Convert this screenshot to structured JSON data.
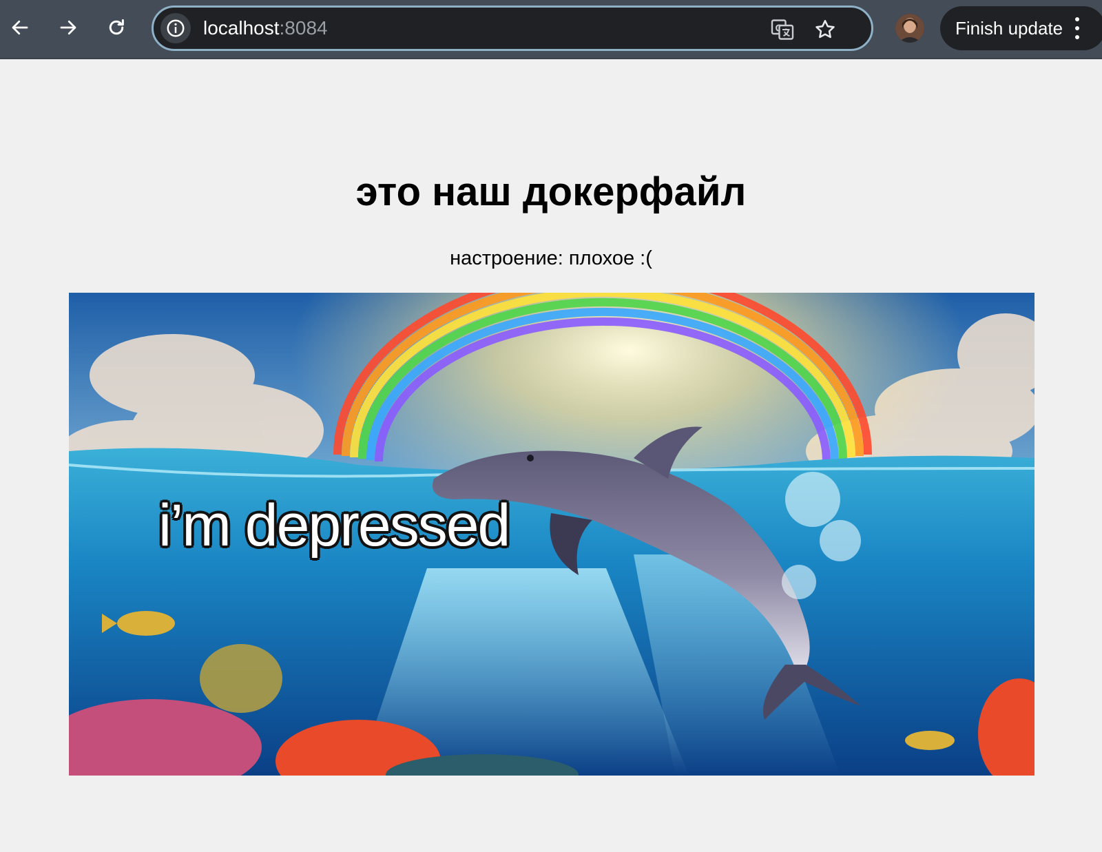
{
  "browser": {
    "url_host": "localhost",
    "url_port": ":8084",
    "update_button_label": "Finish update",
    "icons": {
      "back": "arrow-left-icon",
      "forward": "arrow-right-icon",
      "reload": "reload-icon",
      "site_info": "info-icon",
      "translate": "translate-icon",
      "bookmark": "star-icon",
      "menu": "vertical-dots-icon"
    }
  },
  "page": {
    "title": "это наш докерфайл",
    "mood": "настроение: плохое :(",
    "meme_caption": "i’m depressed"
  },
  "colors": {
    "toolbar": "#434c57",
    "omnibox": "#1f2124",
    "omnibox_border": "#8fb1c8",
    "page_background": "#f0f0f0"
  }
}
